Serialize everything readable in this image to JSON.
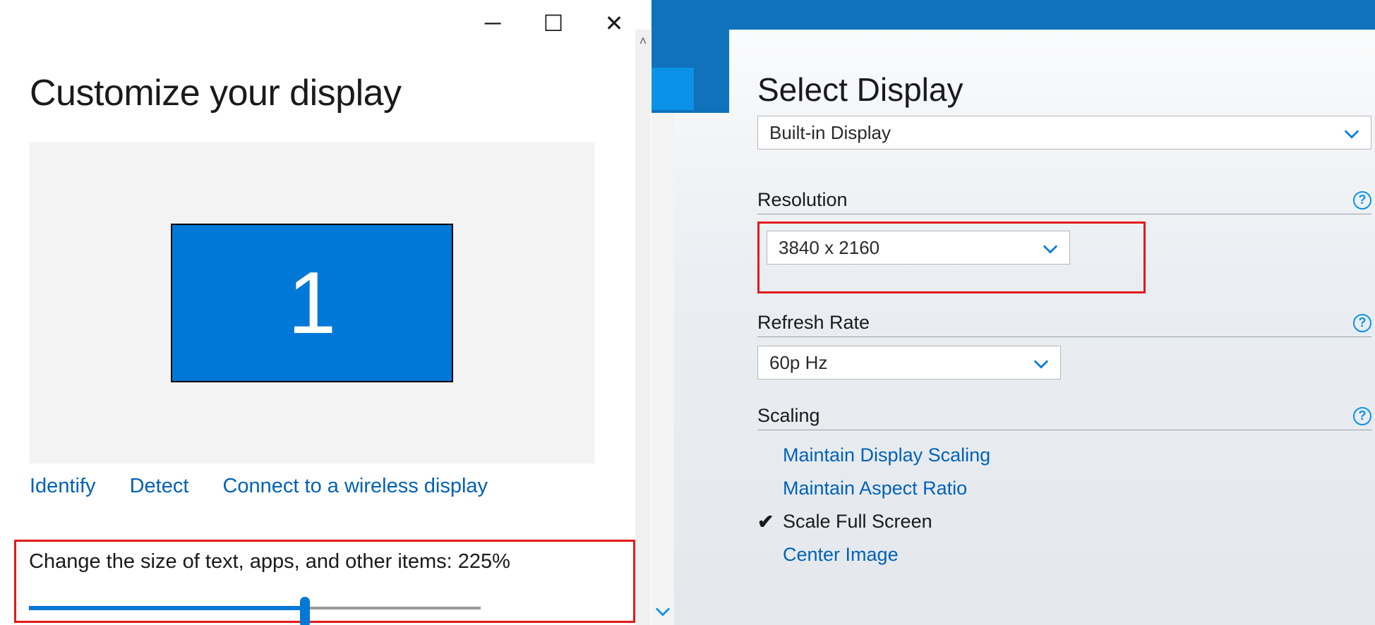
{
  "left": {
    "title": "Customize your display",
    "monitor_number": "1",
    "links": {
      "identify": "Identify",
      "detect": "Detect",
      "wireless": "Connect to a wireless display"
    },
    "scale_label": "Change the size of text, apps, and other items: 225%",
    "slider_percent": 61
  },
  "right": {
    "title": "Select Display",
    "display_select": "Built-in Display",
    "sections": {
      "resolution": {
        "label": "Resolution",
        "value": "3840 x 2160"
      },
      "refresh": {
        "label": "Refresh Rate",
        "value": "60p Hz"
      },
      "scaling": {
        "label": "Scaling",
        "options": {
          "maintain_display": "Maintain Display Scaling",
          "maintain_aspect": "Maintain Aspect Ratio",
          "scale_full": "Scale Full Screen",
          "center_image": "Center Image"
        }
      }
    }
  },
  "glyphs": {
    "minimize": "─",
    "maximize": "☐",
    "close": "✕",
    "question": "?",
    "check": "✔",
    "chev_down": "⌄",
    "up_caret": "˄"
  },
  "colors": {
    "accent": "#0078d7",
    "alert_border": "#e11b1b",
    "link": "#0061b8"
  }
}
